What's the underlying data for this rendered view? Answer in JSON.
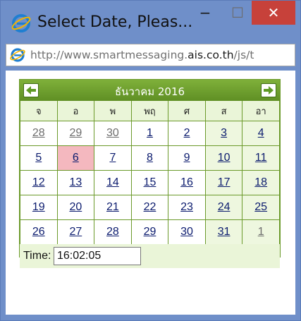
{
  "window": {
    "title": "Select Date, Pleas...",
    "minimize_glyph": "−",
    "maximize_glyph": "☐",
    "close_glyph": "✕",
    "icon": "internet-explorer-icon"
  },
  "address": {
    "prefix": "http://www.smartmessaging.",
    "domain": "ais.co.th",
    "suffix": "/js/t",
    "icon": "internet-explorer-icon"
  },
  "calendar": {
    "month_title": "ธันวาคม 2016",
    "prev_icon": "arrow-left-icon",
    "next_icon": "arrow-right-icon",
    "weekdays": [
      "จ",
      "อ",
      "พ",
      "พฤ",
      "ศ",
      "ส",
      "อา"
    ],
    "weeks": [
      [
        "28",
        "29",
        "30",
        "1",
        "2",
        "3",
        "4"
      ],
      [
        "5",
        "6",
        "7",
        "8",
        "9",
        "10",
        "11"
      ],
      [
        "12",
        "13",
        "14",
        "15",
        "16",
        "17",
        "18"
      ],
      [
        "19",
        "20",
        "21",
        "22",
        "23",
        "24",
        "25"
      ],
      [
        "26",
        "27",
        "28",
        "29",
        "30",
        "31",
        "1"
      ]
    ],
    "time_label": "Time:",
    "time_value": "16:02:05"
  },
  "colors": {
    "header": "#6b9a2a",
    "today": "#f4b8bf",
    "weekend": "#eef7df",
    "close_button": "#c7413a"
  }
}
